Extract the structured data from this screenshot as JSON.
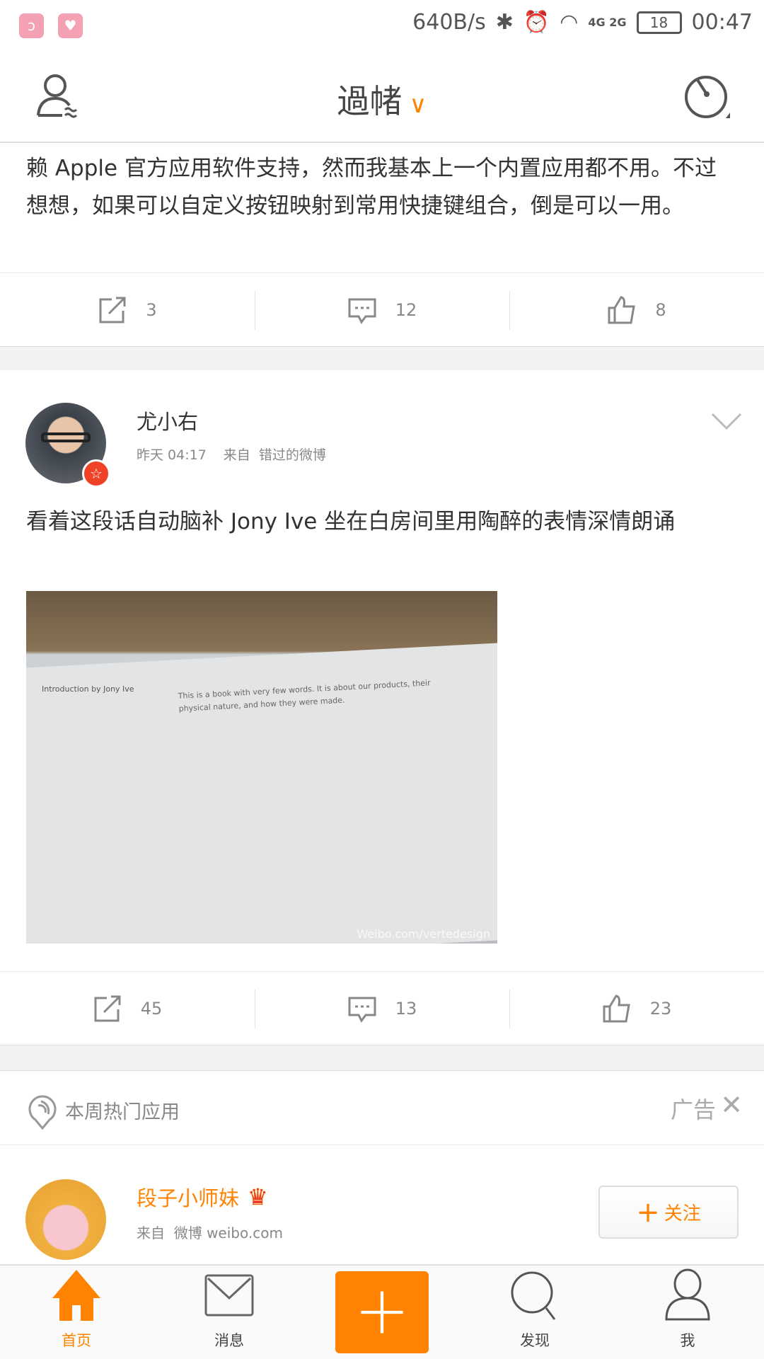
{
  "status_bar": {
    "speed": "640B/s",
    "network": "4G 2G",
    "battery": "18",
    "time": "00:47"
  },
  "header": {
    "title": "過帾",
    "title_icon": "chevron-down-icon",
    "left_icon": "user-friends-icon",
    "right_icon": "radar-icon"
  },
  "post1": {
    "text": "赖 Apple 官方应用软件支持，然而我基本上一个内置应用都不用。不过想想，如果可以自定义按钮映射到常用快捷键组合，倒是可以一用。",
    "reposts": "3",
    "comments": "12",
    "likes": "8"
  },
  "post2": {
    "author": "尤小右",
    "time": "昨天 04:17",
    "source_prefix": "来自",
    "source": "错过的微博",
    "text": "看着这段话自动脑补 Jony Ive 坐在白房间里用陶醉的表情深情朗诵",
    "image_caption": "Introduction by Jony Ive",
    "image_text": "This is a book with very few words. It is about our products, their physical nature, and how they were made.",
    "watermark": "Weibo.com/vertedesign",
    "reposts": "45",
    "comments": "13",
    "likes": "23"
  },
  "hot_apps": {
    "label": "本周热门应用",
    "ad_label": "广告"
  },
  "ad": {
    "name": "段子小师妹",
    "source_prefix": "来自",
    "source": "微博 weibo.com",
    "follow_label": "关注"
  },
  "tabs": [
    {
      "label": "首页"
    },
    {
      "label": "消息"
    },
    {
      "label": ""
    },
    {
      "label": "发现"
    },
    {
      "label": "我"
    }
  ],
  "colors": {
    "accent": "#ff8200"
  }
}
